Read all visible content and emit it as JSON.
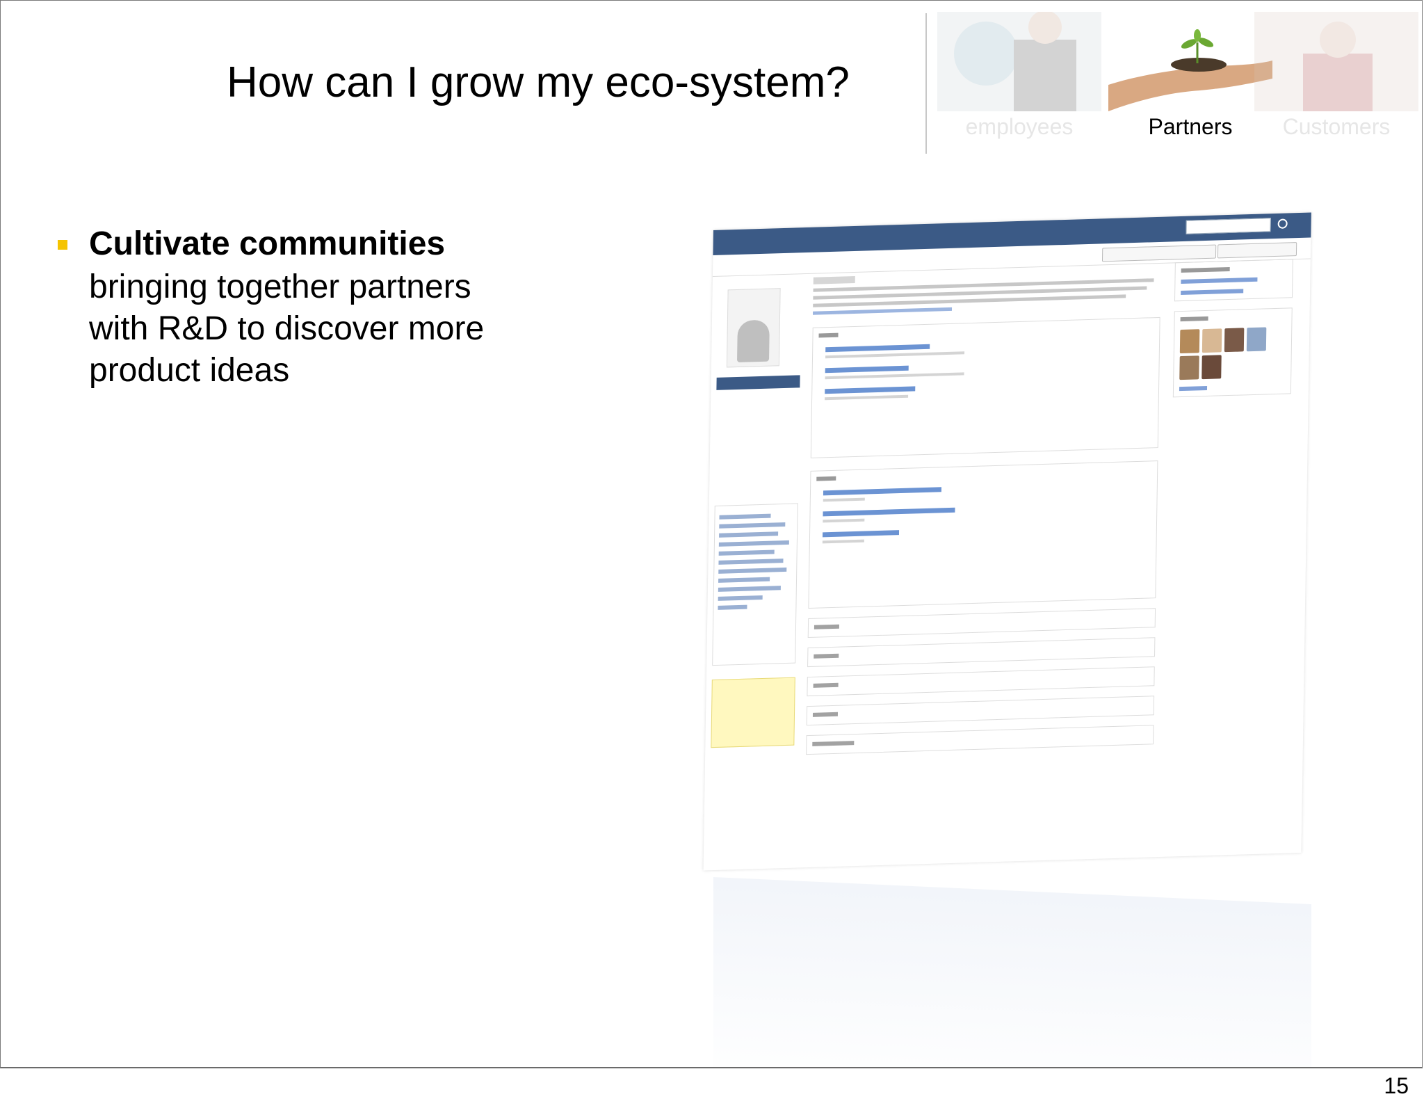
{
  "slide": {
    "title": "How can I grow my eco-system?",
    "page_number": "15"
  },
  "audience_tabs": [
    {
      "label": "employees",
      "state": "faded"
    },
    {
      "label": "Partners",
      "state": "active"
    },
    {
      "label": "Customers",
      "state": "faded"
    }
  ],
  "bullet": {
    "heading": "Cultivate communities",
    "lines": [
      "bringing together partners",
      "with R&D to discover more",
      "product ideas"
    ]
  },
  "colors": {
    "bullet": "#f5c400",
    "header_bar": "#3b5a86",
    "link": "#3a6fc4"
  }
}
